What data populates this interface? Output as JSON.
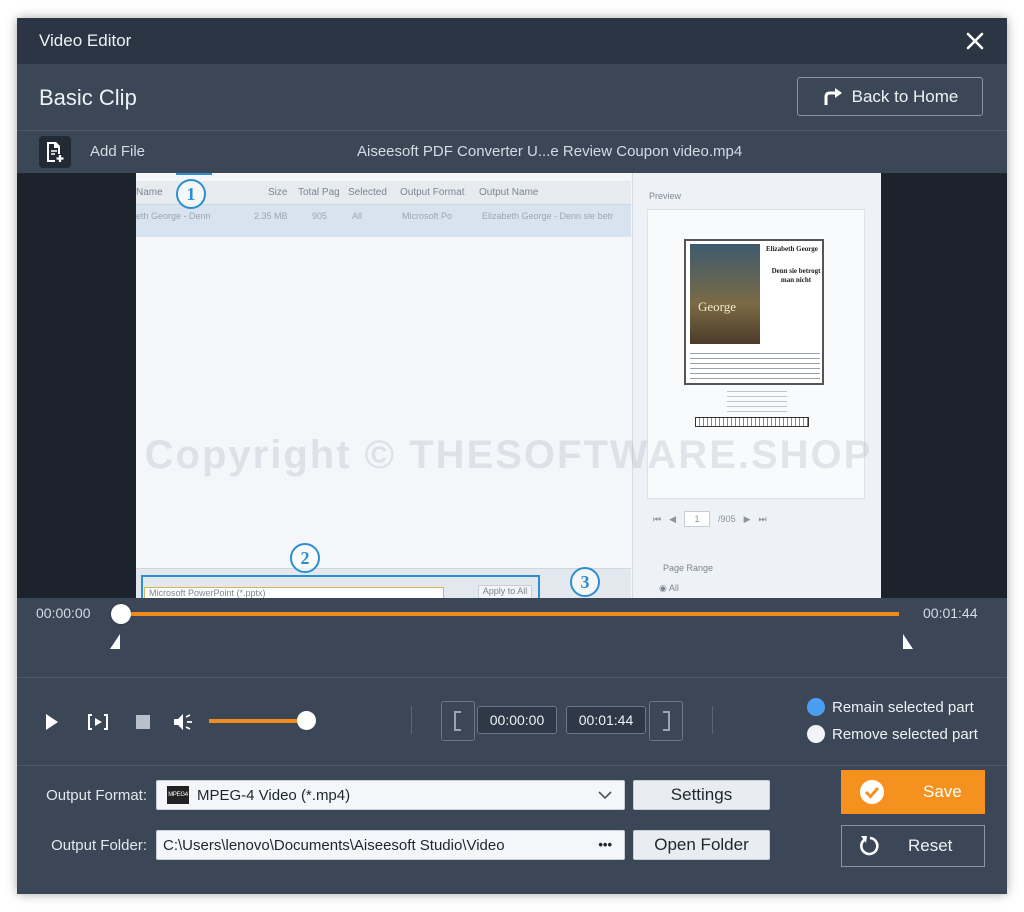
{
  "window": {
    "title": "Video Editor"
  },
  "header": {
    "title": "Basic Clip",
    "back_label": "Back to Home"
  },
  "filebar": {
    "add_file_label": "Add File",
    "file_name": "Aiseesoft PDF Converter U...e Review Coupon video.mp4"
  },
  "video_frame": {
    "table_headers": [
      "Name",
      "Size",
      "Total Pag",
      "Selected",
      "Output Format",
      "Output Name"
    ],
    "table_row": [
      "eth George - Denn",
      "2.35 MB",
      "905",
      "All",
      "Microsoft Po",
      "Elizabeth George - Denn sie betr"
    ],
    "preview_label": "Preview",
    "book_author": "Elizabeth George",
    "book_title": "Denn sie betrogt man nicht",
    "cover_name": "George",
    "page_value": "1",
    "page_total": "/905",
    "page_range_label": "Page Range",
    "page_range_all": "All",
    "format_select": "Microsoft PowerPoint (*.pptx)",
    "apply_all": "Apply to All",
    "markers": [
      "1",
      "2",
      "3"
    ],
    "watermark": "Copyright © THESOFTWARE.SHOP"
  },
  "timeline": {
    "start_time": "00:00:00",
    "end_time": "00:01:44",
    "progress": 0.0
  },
  "controls": {
    "volume_level": 0.9,
    "clip_start": "00:00:00",
    "clip_end": "00:01:44",
    "remain_label": "Remain selected part",
    "remove_label": "Remove selected part",
    "selected_mode": "remain"
  },
  "output": {
    "format_label": "Output Format:",
    "format_value": "MPEG-4 Video (*.mp4)",
    "format_icon": "MPEG4",
    "settings_label": "Settings",
    "folder_label": "Output Folder:",
    "folder_value": "C:\\Users\\lenovo\\Documents\\Aiseesoft Studio\\Video",
    "browse_label": "•••",
    "open_folder_label": "Open Folder",
    "save_label": "Save",
    "reset_label": "Reset"
  },
  "colors": {
    "accent": "#f5911e",
    "radio_selected": "#4a9ef0",
    "bg": "#3b4657",
    "titlebar": "#2c3543"
  }
}
